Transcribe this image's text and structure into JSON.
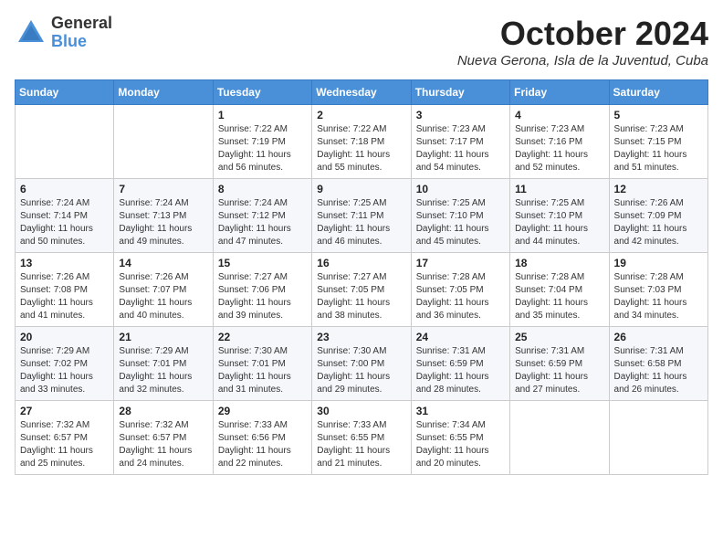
{
  "header": {
    "logo": {
      "general": "General",
      "blue": "Blue"
    },
    "title": "October 2024",
    "location": "Nueva Gerona, Isla de la Juventud, Cuba"
  },
  "days_of_week": [
    "Sunday",
    "Monday",
    "Tuesday",
    "Wednesday",
    "Thursday",
    "Friday",
    "Saturday"
  ],
  "weeks": [
    [
      {
        "day": "",
        "sunrise": "",
        "sunset": "",
        "daylight": ""
      },
      {
        "day": "",
        "sunrise": "",
        "sunset": "",
        "daylight": ""
      },
      {
        "day": "1",
        "sunrise": "Sunrise: 7:22 AM",
        "sunset": "Sunset: 7:19 PM",
        "daylight": "Daylight: 11 hours and 56 minutes."
      },
      {
        "day": "2",
        "sunrise": "Sunrise: 7:22 AM",
        "sunset": "Sunset: 7:18 PM",
        "daylight": "Daylight: 11 hours and 55 minutes."
      },
      {
        "day": "3",
        "sunrise": "Sunrise: 7:23 AM",
        "sunset": "Sunset: 7:17 PM",
        "daylight": "Daylight: 11 hours and 54 minutes."
      },
      {
        "day": "4",
        "sunrise": "Sunrise: 7:23 AM",
        "sunset": "Sunset: 7:16 PM",
        "daylight": "Daylight: 11 hours and 52 minutes."
      },
      {
        "day": "5",
        "sunrise": "Sunrise: 7:23 AM",
        "sunset": "Sunset: 7:15 PM",
        "daylight": "Daylight: 11 hours and 51 minutes."
      }
    ],
    [
      {
        "day": "6",
        "sunrise": "Sunrise: 7:24 AM",
        "sunset": "Sunset: 7:14 PM",
        "daylight": "Daylight: 11 hours and 50 minutes."
      },
      {
        "day": "7",
        "sunrise": "Sunrise: 7:24 AM",
        "sunset": "Sunset: 7:13 PM",
        "daylight": "Daylight: 11 hours and 49 minutes."
      },
      {
        "day": "8",
        "sunrise": "Sunrise: 7:24 AM",
        "sunset": "Sunset: 7:12 PM",
        "daylight": "Daylight: 11 hours and 47 minutes."
      },
      {
        "day": "9",
        "sunrise": "Sunrise: 7:25 AM",
        "sunset": "Sunset: 7:11 PM",
        "daylight": "Daylight: 11 hours and 46 minutes."
      },
      {
        "day": "10",
        "sunrise": "Sunrise: 7:25 AM",
        "sunset": "Sunset: 7:10 PM",
        "daylight": "Daylight: 11 hours and 45 minutes."
      },
      {
        "day": "11",
        "sunrise": "Sunrise: 7:25 AM",
        "sunset": "Sunset: 7:10 PM",
        "daylight": "Daylight: 11 hours and 44 minutes."
      },
      {
        "day": "12",
        "sunrise": "Sunrise: 7:26 AM",
        "sunset": "Sunset: 7:09 PM",
        "daylight": "Daylight: 11 hours and 42 minutes."
      }
    ],
    [
      {
        "day": "13",
        "sunrise": "Sunrise: 7:26 AM",
        "sunset": "Sunset: 7:08 PM",
        "daylight": "Daylight: 11 hours and 41 minutes."
      },
      {
        "day": "14",
        "sunrise": "Sunrise: 7:26 AM",
        "sunset": "Sunset: 7:07 PM",
        "daylight": "Daylight: 11 hours and 40 minutes."
      },
      {
        "day": "15",
        "sunrise": "Sunrise: 7:27 AM",
        "sunset": "Sunset: 7:06 PM",
        "daylight": "Daylight: 11 hours and 39 minutes."
      },
      {
        "day": "16",
        "sunrise": "Sunrise: 7:27 AM",
        "sunset": "Sunset: 7:05 PM",
        "daylight": "Daylight: 11 hours and 38 minutes."
      },
      {
        "day": "17",
        "sunrise": "Sunrise: 7:28 AM",
        "sunset": "Sunset: 7:05 PM",
        "daylight": "Daylight: 11 hours and 36 minutes."
      },
      {
        "day": "18",
        "sunrise": "Sunrise: 7:28 AM",
        "sunset": "Sunset: 7:04 PM",
        "daylight": "Daylight: 11 hours and 35 minutes."
      },
      {
        "day": "19",
        "sunrise": "Sunrise: 7:28 AM",
        "sunset": "Sunset: 7:03 PM",
        "daylight": "Daylight: 11 hours and 34 minutes."
      }
    ],
    [
      {
        "day": "20",
        "sunrise": "Sunrise: 7:29 AM",
        "sunset": "Sunset: 7:02 PM",
        "daylight": "Daylight: 11 hours and 33 minutes."
      },
      {
        "day": "21",
        "sunrise": "Sunrise: 7:29 AM",
        "sunset": "Sunset: 7:01 PM",
        "daylight": "Daylight: 11 hours and 32 minutes."
      },
      {
        "day": "22",
        "sunrise": "Sunrise: 7:30 AM",
        "sunset": "Sunset: 7:01 PM",
        "daylight": "Daylight: 11 hours and 31 minutes."
      },
      {
        "day": "23",
        "sunrise": "Sunrise: 7:30 AM",
        "sunset": "Sunset: 7:00 PM",
        "daylight": "Daylight: 11 hours and 29 minutes."
      },
      {
        "day": "24",
        "sunrise": "Sunrise: 7:31 AM",
        "sunset": "Sunset: 6:59 PM",
        "daylight": "Daylight: 11 hours and 28 minutes."
      },
      {
        "day": "25",
        "sunrise": "Sunrise: 7:31 AM",
        "sunset": "Sunset: 6:59 PM",
        "daylight": "Daylight: 11 hours and 27 minutes."
      },
      {
        "day": "26",
        "sunrise": "Sunrise: 7:31 AM",
        "sunset": "Sunset: 6:58 PM",
        "daylight": "Daylight: 11 hours and 26 minutes."
      }
    ],
    [
      {
        "day": "27",
        "sunrise": "Sunrise: 7:32 AM",
        "sunset": "Sunset: 6:57 PM",
        "daylight": "Daylight: 11 hours and 25 minutes."
      },
      {
        "day": "28",
        "sunrise": "Sunrise: 7:32 AM",
        "sunset": "Sunset: 6:57 PM",
        "daylight": "Daylight: 11 hours and 24 minutes."
      },
      {
        "day": "29",
        "sunrise": "Sunrise: 7:33 AM",
        "sunset": "Sunset: 6:56 PM",
        "daylight": "Daylight: 11 hours and 22 minutes."
      },
      {
        "day": "30",
        "sunrise": "Sunrise: 7:33 AM",
        "sunset": "Sunset: 6:55 PM",
        "daylight": "Daylight: 11 hours and 21 minutes."
      },
      {
        "day": "31",
        "sunrise": "Sunrise: 7:34 AM",
        "sunset": "Sunset: 6:55 PM",
        "daylight": "Daylight: 11 hours and 20 minutes."
      },
      {
        "day": "",
        "sunrise": "",
        "sunset": "",
        "daylight": ""
      },
      {
        "day": "",
        "sunrise": "",
        "sunset": "",
        "daylight": ""
      }
    ]
  ]
}
